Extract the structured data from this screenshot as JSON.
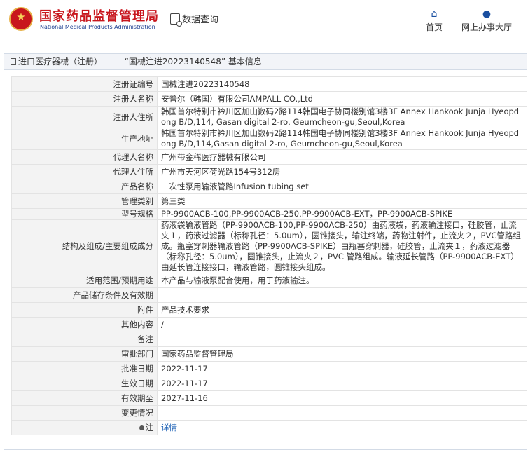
{
  "header": {
    "brand_cn": "国家药品监督管理局",
    "brand_en": "National Medical Products Administration",
    "search_label": "数据查询",
    "nav": [
      {
        "label": "首页",
        "icon": "home-icon"
      },
      {
        "label": "网上办事大厅",
        "icon": "user-icon"
      }
    ]
  },
  "breadcrumb": "进口医疗器械（注册） —— “国械注进20223140548” 基本信息",
  "rows": [
    {
      "key": "注册证编号",
      "value": "国械注进20223140548"
    },
    {
      "key": "注册人名称",
      "value": "安普尔（韩国）有限公司AMPALL CO.,Ltd"
    },
    {
      "key": "注册人住所",
      "value": "韩国首尔特别市衿川区加山数码2路114韩国电子协同楼别馆3楼3F Annex Hankook Junja Hyeopdong B/D,114, Gasan digital 2-ro, Geumcheon-gu,Seoul,Korea"
    },
    {
      "key": "生产地址",
      "value": "韩国首尔特别市衿川区加山数码2路114韩国电子协同楼别馆3楼3F Annex Hankook Junja Hyeopdong B/D,114,Gasan digital 2-ro, Geumcheon-gu,Seoul,Korea"
    },
    {
      "key": "代理人名称",
      "value": "广州带金稀医疗器械有限公司"
    },
    {
      "key": "代理人住所",
      "value": "广州市天河区荷光路154号312房"
    },
    {
      "key": "产品名称",
      "value": "一次性泵用输液管路Infusion tubing set"
    },
    {
      "key": "管理类别",
      "value": "第三类"
    },
    {
      "key": "型号规格",
      "value": "PP-9900ACB-100,PP-9900ACB-250,PP-9900ACB-EXT，PP-9900ACB-SPIKE"
    },
    {
      "key": "结构及组成/主要组成成分",
      "value": "药液袋输液管路（PP-9900ACB-100,PP-9900ACB-250）由药液袋，药液输注接口，硅胶管，止流夹１，药液过滤器（标称孔径：5.0um），圆锥接头，输注终端，药物注射件，止流夹２，PVC管路组成。瓶塞穿刺器输液管路（PP-9900ACB-SPIKE）由瓶塞穿刺器，硅胶管，止流夹１，药液过滤器（标称孔径：5.0um），圆锥接头，止流夹２，PVC 管路组成。输液延长管路（PP-9900ACB-EXT）由延长管连接接口，输液管路，圆锥接头组成。"
    },
    {
      "key": "适用范围/预期用途",
      "value": "本产品与输液泵配合使用，用于药液输注。"
    },
    {
      "key": "产品储存条件及有效期",
      "value": ""
    },
    {
      "key": "附件",
      "value": "产品技术要求"
    },
    {
      "key": "其他内容",
      "value": "/"
    },
    {
      "key": "备注",
      "value": ""
    },
    {
      "key": "审批部门",
      "value": "国家药品监督管理局"
    },
    {
      "key": "批准日期",
      "value": "2022-11-17"
    },
    {
      "key": "生效日期",
      "value": "2022-11-17"
    },
    {
      "key": "有效期至",
      "value": "2027-11-16"
    },
    {
      "key": "变更情况",
      "value": ""
    }
  ],
  "note": {
    "key": "注",
    "value": "详情",
    "icon": "bulb-icon"
  },
  "colors": {
    "brand_red": "#c8161d",
    "link_blue": "#1a5fb4"
  }
}
